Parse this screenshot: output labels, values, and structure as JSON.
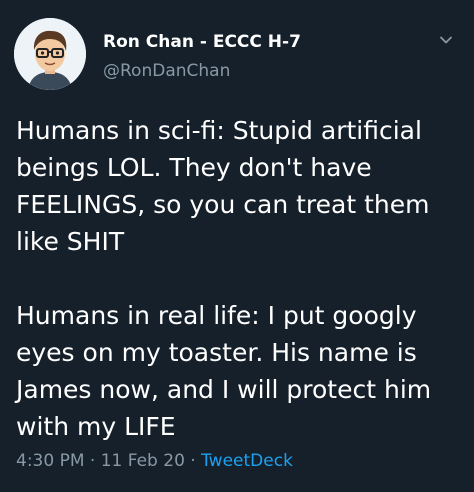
{
  "tweet": {
    "author": {
      "display_name": "Ron Chan - ECCC H-7",
      "handle": "@RonDanChan",
      "avatar_icon": "cartoon-avatar-icon"
    },
    "menu_icon": "chevron-down-icon",
    "text": "Humans in sci-fi: Stupid artificial beings LOL. They don't have FEELINGS, so you can treat them like SHIT\n\nHumans in real life: I put googly eyes on my toaster. His name is James now, and I will protect him with my LIFE",
    "time": "4:30 PM",
    "separator": "·",
    "date": "11 Feb 20",
    "source": "TweetDeck"
  },
  "colors": {
    "background": "#15202b",
    "primary_text": "#ffffff",
    "secondary_text": "#8899a6",
    "link": "#1da1f2"
  }
}
